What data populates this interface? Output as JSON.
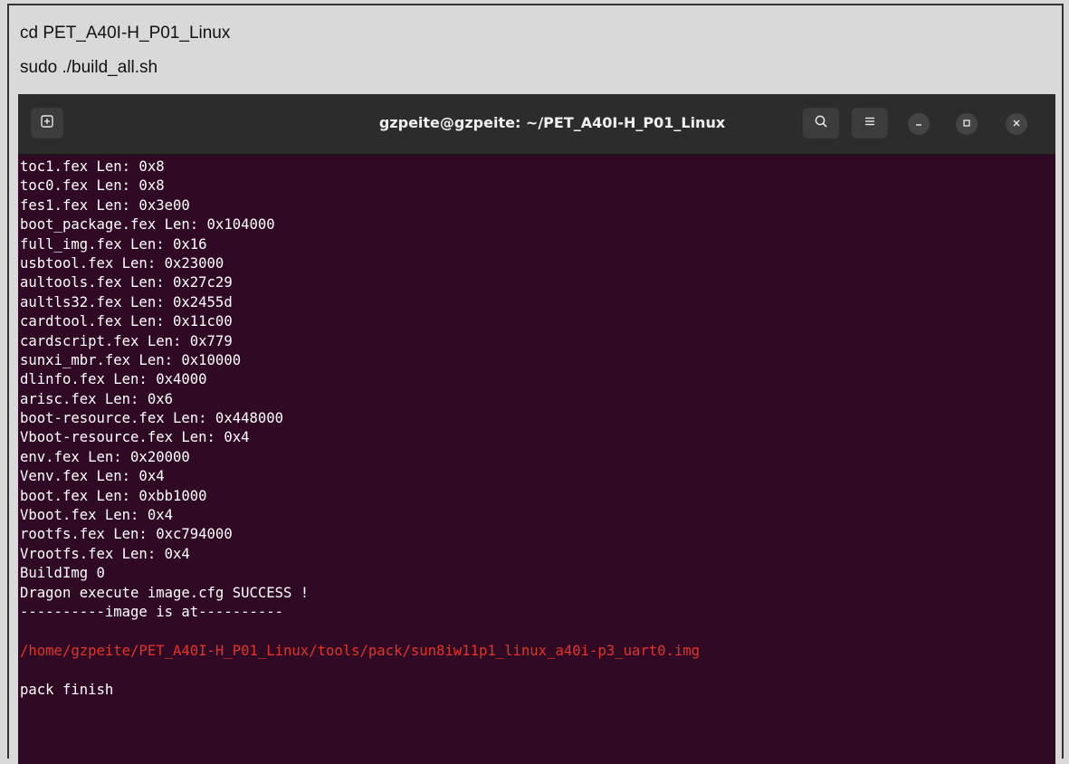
{
  "document": {
    "lines": [
      "cd PET_A40I-H_P01_Linux",
      "sudo ./build_all.sh"
    ]
  },
  "terminal": {
    "title": "gzpeite@gzpeite: ~/PET_A40I-H_P01_Linux",
    "icons": {
      "new_tab": "new-tab-icon",
      "search": "search-icon",
      "menu": "hamburger-menu-icon",
      "minimize": "minimize-icon",
      "maximize": "maximize-icon",
      "close": "close-icon"
    },
    "colors": {
      "background": "#300a24",
      "text": "#ffffff",
      "highlight": "#e0342b"
    },
    "output": [
      {
        "text": "toc1.fex Len: 0x8",
        "color": "default"
      },
      {
        "text": "toc0.fex Len: 0x8",
        "color": "default"
      },
      {
        "text": "fes1.fex Len: 0x3e00",
        "color": "default"
      },
      {
        "text": "boot_package.fex Len: 0x104000",
        "color": "default"
      },
      {
        "text": "full_img.fex Len: 0x16",
        "color": "default"
      },
      {
        "text": "usbtool.fex Len: 0x23000",
        "color": "default"
      },
      {
        "text": "aultools.fex Len: 0x27c29",
        "color": "default"
      },
      {
        "text": "aultls32.fex Len: 0x2455d",
        "color": "default"
      },
      {
        "text": "cardtool.fex Len: 0x11c00",
        "color": "default"
      },
      {
        "text": "cardscript.fex Len: 0x779",
        "color": "default"
      },
      {
        "text": "sunxi_mbr.fex Len: 0x10000",
        "color": "default"
      },
      {
        "text": "dlinfo.fex Len: 0x4000",
        "color": "default"
      },
      {
        "text": "arisc.fex Len: 0x6",
        "color": "default"
      },
      {
        "text": "boot-resource.fex Len: 0x448000",
        "color": "default"
      },
      {
        "text": "Vboot-resource.fex Len: 0x4",
        "color": "default"
      },
      {
        "text": "env.fex Len: 0x20000",
        "color": "default"
      },
      {
        "text": "Venv.fex Len: 0x4",
        "color": "default"
      },
      {
        "text": "boot.fex Len: 0xbb1000",
        "color": "default"
      },
      {
        "text": "Vboot.fex Len: 0x4",
        "color": "default"
      },
      {
        "text": "rootfs.fex Len: 0xc794000",
        "color": "default"
      },
      {
        "text": "Vrootfs.fex Len: 0x4",
        "color": "default"
      },
      {
        "text": "BuildImg 0",
        "color": "default"
      },
      {
        "text": "Dragon execute image.cfg SUCCESS !",
        "color": "default"
      },
      {
        "text": "----------image is at----------",
        "color": "default"
      },
      {
        "text": "",
        "color": "default"
      },
      {
        "text": "/home/gzpeite/PET_A40I-H_P01_Linux/tools/pack/sun8iw11p1_linux_a40i-p3_uart0.img",
        "color": "red"
      },
      {
        "text": "",
        "color": "default"
      },
      {
        "text": "pack finish",
        "color": "default"
      }
    ]
  }
}
